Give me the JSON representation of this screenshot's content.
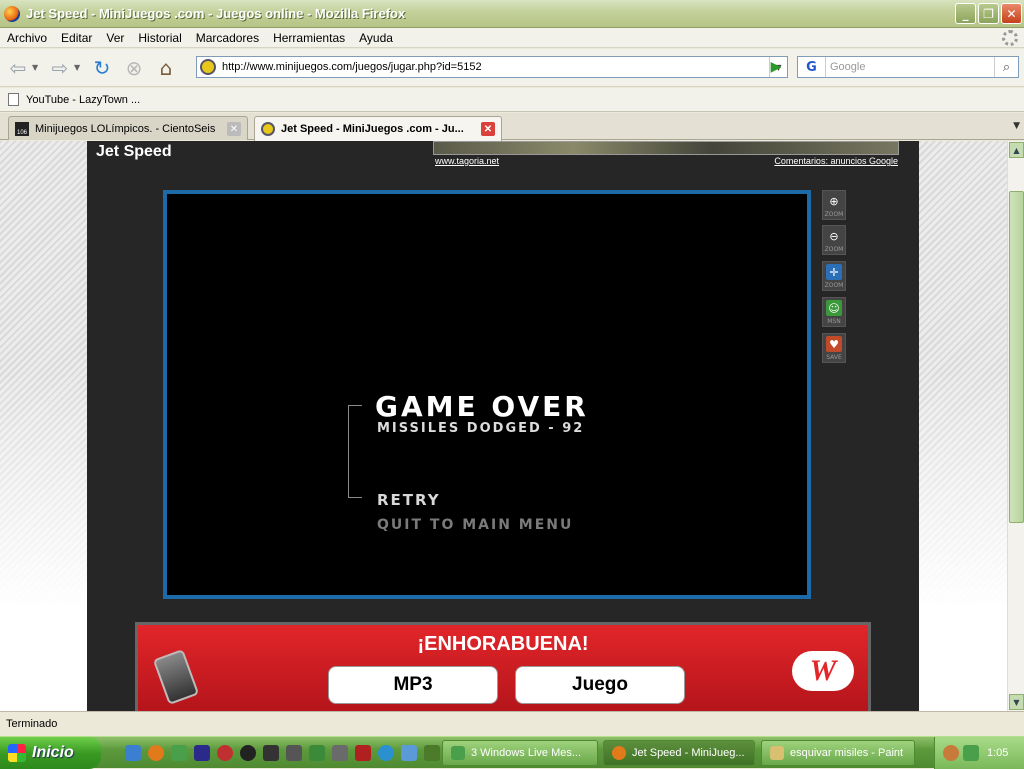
{
  "window": {
    "title": "Jet Speed - MiniJuegos .com - Juegos online - Mozilla Firefox"
  },
  "menu": [
    "Archivo",
    "Editar",
    "Ver",
    "Historial",
    "Marcadores",
    "Herramientas",
    "Ayuda"
  ],
  "nav": {
    "url": "http://www.minijuegos.com/juegos/jugar.php?id=5152",
    "search_placeholder": "Google"
  },
  "bookmarks": [
    {
      "label": "YouTube - LazyTown ..."
    }
  ],
  "tabs": [
    {
      "label": "Minijuegos LOLímpicos. - CientoSeis",
      "icon_text": "106",
      "active": false
    },
    {
      "label": "Jet Speed - MiniJuegos .com - Ju...",
      "active": true
    }
  ],
  "page": {
    "title": "Jet Speed",
    "ad_link_left": "www.tagoria.net",
    "ad_link_right": "Comentarios: anuncios Google",
    "game": {
      "heading": "GAME OVER",
      "missiles_label": "MISSILES DODGED - 92",
      "retry": "RETRY",
      "quit": "QUIT TO MAIN MENU"
    },
    "side_tools": [
      {
        "label": "ZOOM",
        "icon": "zoom-in-icon"
      },
      {
        "label": "ZOOM",
        "icon": "zoom-out-icon"
      },
      {
        "label": "ZOOM",
        "icon": "fit-zoom-icon"
      },
      {
        "label": "MSN",
        "icon": "msn-icon"
      },
      {
        "label": "SAVE",
        "icon": "save-icon"
      }
    ],
    "banner": {
      "title": "¡ENHORABUENA!",
      "btn_mp3": "MP3",
      "btn_juego": "Juego"
    }
  },
  "status": {
    "text": "Terminado"
  },
  "taskbar": {
    "start": "Inicio",
    "buttons": [
      {
        "label": "3 Windows Live Mes...",
        "active": false
      },
      {
        "label": "Jet Speed - MiniJueg...",
        "active": true
      },
      {
        "label": "esquivar misiles - Paint",
        "active": false
      }
    ],
    "clock": "1:05"
  },
  "colors": {
    "game_border": "#1d6aa8",
    "banner_red": "#e2262a",
    "title_bar": "#c3d09a"
  }
}
